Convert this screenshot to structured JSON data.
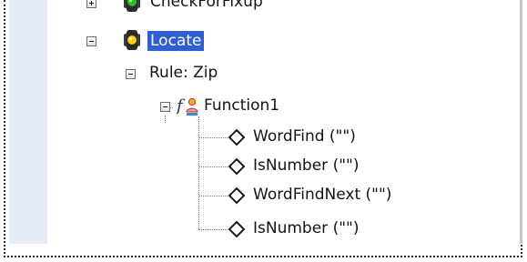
{
  "tree": {
    "nodes": [
      {
        "label": "CheckForFixup",
        "icon": "traffic-light-icon",
        "expander": "plus"
      },
      {
        "label": "Locate",
        "icon": "traffic-light-icon",
        "expander": "minus",
        "selected": true
      },
      {
        "label": "Rule: Zip",
        "expander": "minus"
      },
      {
        "label": "Function1",
        "icon": "function-icon",
        "expander": "minus"
      },
      {
        "label": "WordFind (\"\")",
        "icon": "diamond-icon"
      },
      {
        "label": "IsNumber (\"\")",
        "icon": "diamond-icon"
      },
      {
        "label": "WordFindNext (\"\")",
        "icon": "diamond-icon"
      },
      {
        "label": "IsNumber (\"\")",
        "icon": "diamond-icon"
      }
    ]
  },
  "colors": {
    "selection": "#2f5fd6",
    "gutter": "#e6ebf8",
    "traffic_light_lamp": "#f5d000",
    "function_glyph": "#d07020"
  }
}
